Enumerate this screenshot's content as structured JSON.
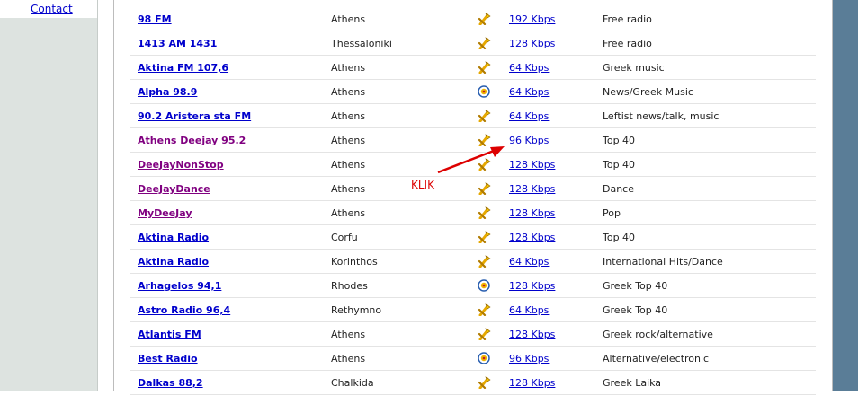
{
  "sidebar": {
    "contact_label": "Contact"
  },
  "annotation": {
    "label": "KLIK"
  },
  "stations": [
    {
      "name": "98 FM",
      "city": "Athens",
      "icon": "winamp-icon",
      "bitrate": "192 Kbps",
      "genre": "Free radio",
      "visited": false
    },
    {
      "name": "1413 AM 1431",
      "city": "Thessaloniki",
      "icon": "winamp-icon",
      "bitrate": "128 Kbps",
      "genre": "Free radio",
      "visited": false
    },
    {
      "name": "Aktina FM 107,6",
      "city": "Athens",
      "icon": "winamp-icon",
      "bitrate": "64 Kbps",
      "genre": "Greek music",
      "visited": false
    },
    {
      "name": "Alpha 98.9",
      "city": "Athens",
      "icon": "realplayer-icon",
      "bitrate": "64 Kbps",
      "genre": "News/Greek Music",
      "visited": false
    },
    {
      "name": "90.2 Aristera sta FM",
      "city": "Athens",
      "icon": "winamp-icon",
      "bitrate": "64 Kbps",
      "genre": "Leftist news/talk, music",
      "visited": false
    },
    {
      "name": "Athens Deejay 95.2",
      "city": "Athens",
      "icon": "winamp-icon",
      "bitrate": "96 Kbps",
      "genre": "Top 40",
      "visited": true
    },
    {
      "name": "DeeJayNonStop",
      "city": "Athens",
      "icon": "winamp-icon",
      "bitrate": "128 Kbps",
      "genre": "Top 40",
      "visited": true
    },
    {
      "name": "DeeJayDance",
      "city": "Athens",
      "icon": "winamp-icon",
      "bitrate": "128 Kbps",
      "genre": "Dance",
      "visited": true
    },
    {
      "name": "MyDeeJay",
      "city": "Athens",
      "icon": "winamp-icon",
      "bitrate": "128 Kbps",
      "genre": "Pop",
      "visited": true
    },
    {
      "name": "Aktina Radio",
      "city": "Corfu",
      "icon": "winamp-icon",
      "bitrate": "128 Kbps",
      "genre": "Top 40",
      "visited": false
    },
    {
      "name": "Aktina Radio",
      "city": "Korinthos",
      "icon": "winamp-icon",
      "bitrate": "64 Kbps",
      "genre": "International Hits/Dance",
      "visited": false
    },
    {
      "name": "Arhagelos 94,1",
      "city": "Rhodes",
      "icon": "realplayer-icon",
      "bitrate": "128 Kbps",
      "genre": "Greek Top 40",
      "visited": false
    },
    {
      "name": "Astro Radio 96,4",
      "city": "Rethymno",
      "icon": "winamp-icon",
      "bitrate": "64 Kbps",
      "genre": "Greek Top 40",
      "visited": false
    },
    {
      "name": "Atlantis FM",
      "city": "Athens",
      "icon": "winamp-icon",
      "bitrate": "128 Kbps",
      "genre": "Greek rock/alternative",
      "visited": false
    },
    {
      "name": "Best Radio",
      "city": "Athens",
      "icon": "realplayer-icon",
      "bitrate": "96 Kbps",
      "genre": "Alternative/electronic",
      "visited": false
    },
    {
      "name": "Dalkas 88,2",
      "city": "Chalkida",
      "icon": "winamp-icon",
      "bitrate": "128 Kbps",
      "genre": "Greek Laika",
      "visited": false
    }
  ],
  "colors": {
    "link": "#0000cc",
    "visited_link": "#800080",
    "annotation": "#dd0000",
    "right_panel": "#5a7d97",
    "left_panel": "#dde3e0"
  }
}
